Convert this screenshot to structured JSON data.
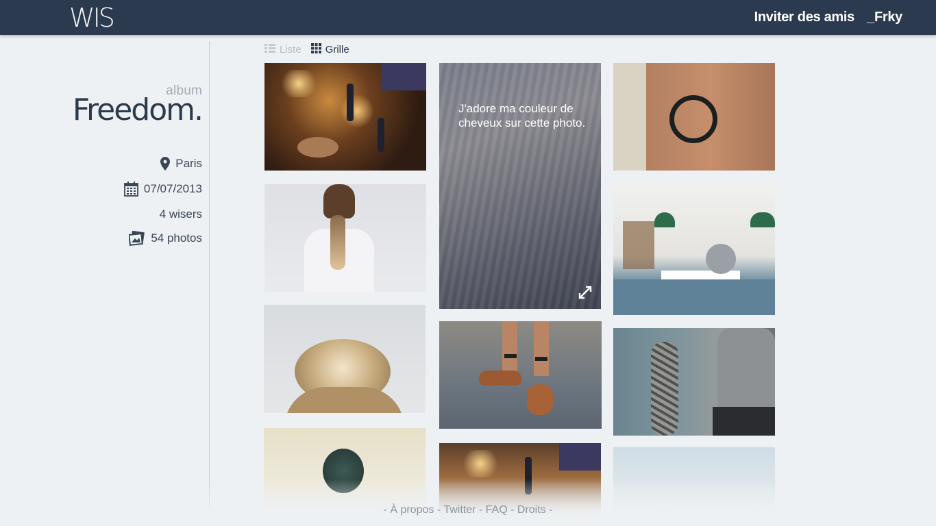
{
  "header": {
    "logo": "WIS",
    "invite_label": "Inviter des amis",
    "user_label": "_Frky"
  },
  "sidebar": {
    "album_label": "album",
    "album_title": "Freedom.",
    "city": "Paris",
    "date": "07/07/2013",
    "wisers": "4 wisers",
    "photos": "54 photos"
  },
  "view_toggle": {
    "list_label": "Liste",
    "grid_label": "Grille",
    "active": "grid"
  },
  "photos": {
    "featured_caption": "J'adore ma couleur de cheveux sur cette photo."
  },
  "footer": {
    "prefix": "- ",
    "about": "À propos",
    "twitter": "Twitter",
    "faq": "FAQ",
    "rights": "Droits",
    "separator": " - ",
    "suffix": " -"
  },
  "colors": {
    "header_bg": "#2b3a4f",
    "page_bg": "#eef1f3",
    "text_dark": "#2b3a4d",
    "text_muted": "#a3acb6"
  },
  "icons": [
    "map-pin-icon",
    "calendar-icon",
    "photos-icon",
    "list-view-icon",
    "grid-view-icon",
    "expand-icon"
  ]
}
